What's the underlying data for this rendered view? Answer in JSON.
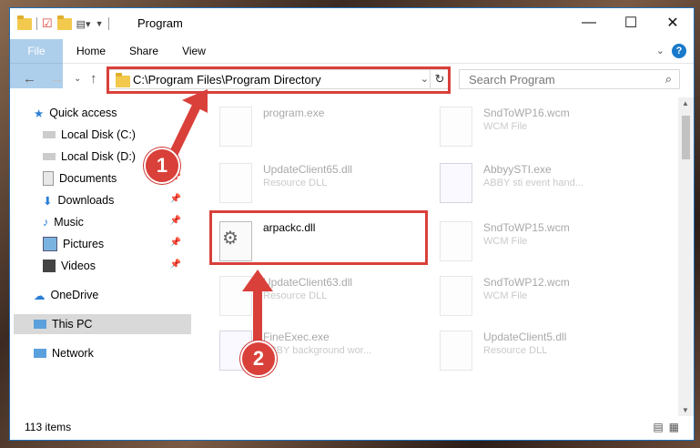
{
  "window": {
    "title": "Program"
  },
  "ribbon": {
    "tabs": [
      "File",
      "Home",
      "Share",
      "View"
    ],
    "help": "?"
  },
  "address": {
    "path": "C:\\Program Files\\Program Directory"
  },
  "search": {
    "placeholder": "Search Program"
  },
  "sidebar": {
    "items": [
      {
        "label": "Quick access",
        "icon": "star-icon"
      },
      {
        "label": "Local Disk (C:)",
        "icon": "drive-icon"
      },
      {
        "label": "Local Disk (D:)",
        "icon": "drive-icon"
      },
      {
        "label": "Documents",
        "icon": "documents-icon"
      },
      {
        "label": "Downloads",
        "icon": "download-icon"
      },
      {
        "label": "Music",
        "icon": "music-icon"
      },
      {
        "label": "Pictures",
        "icon": "pictures-icon"
      },
      {
        "label": "Videos",
        "icon": "videos-icon"
      },
      {
        "label": "OneDrive",
        "icon": "cloud-icon"
      },
      {
        "label": "This PC",
        "icon": "computer-icon"
      },
      {
        "label": "Network",
        "icon": "network-icon"
      }
    ]
  },
  "files": [
    {
      "name": "program.exe",
      "desc": ""
    },
    {
      "name": "SndToWP16.wcm",
      "desc": "WCM File"
    },
    {
      "name": "UpdateClient65.dll",
      "desc": "Resource DLL"
    },
    {
      "name": "AbbyySTI.exe",
      "desc": "ABBY sti event hand..."
    },
    {
      "name": "arpackc.dll",
      "desc": ""
    },
    {
      "name": "SndToWP15.wcm",
      "desc": "WCM File"
    },
    {
      "name": "UpdateClient63.dll",
      "desc": "Resource DLL"
    },
    {
      "name": "SndToWP12.wcm",
      "desc": "WCM File"
    },
    {
      "name": "FineExec.exe",
      "desc": "ABBY background wor..."
    },
    {
      "name": "UpdateClient5.dll",
      "desc": "Resource DLL"
    }
  ],
  "status": {
    "items": "113 items"
  },
  "annotations": {
    "one": "1",
    "two": "2"
  },
  "colors": {
    "accent": "#1979ca",
    "highlight": "#d9403a"
  }
}
